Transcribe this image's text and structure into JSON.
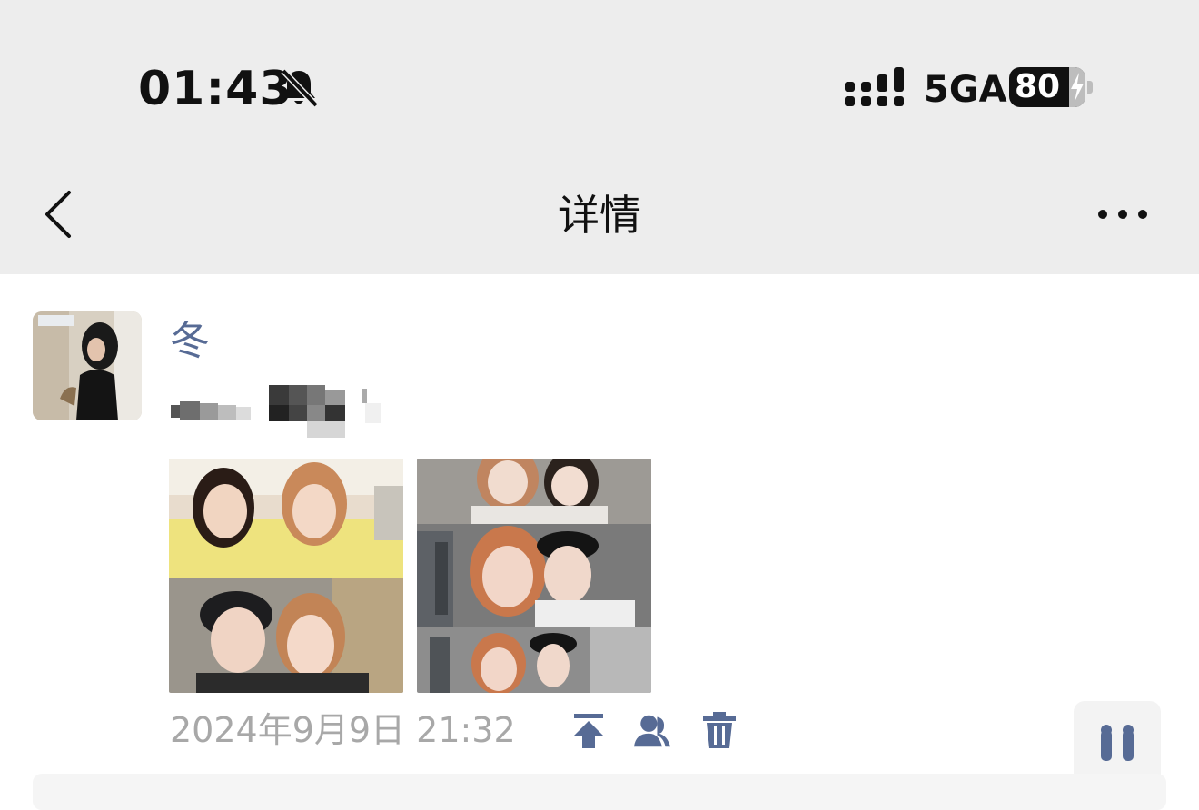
{
  "status_bar": {
    "time": "01:43",
    "network": "5GA",
    "battery": "80",
    "icons": [
      "bell-muted-icon",
      "signal-icon",
      "battery-charging-icon"
    ]
  },
  "nav": {
    "title": "详情",
    "back_icon": "chevron-left-icon",
    "more_icon": "more-horizontal-icon"
  },
  "post": {
    "user_name": "冬",
    "photo_count": 2,
    "timestamp": "2024年9月9日 21:32",
    "action_icons": [
      "pin-top-icon",
      "visibility-people-icon",
      "trash-icon"
    ]
  },
  "colors": {
    "link_blue": "#576b95",
    "timestamp_gray": "#a8a8a8",
    "bar_bg": "#ededed"
  }
}
